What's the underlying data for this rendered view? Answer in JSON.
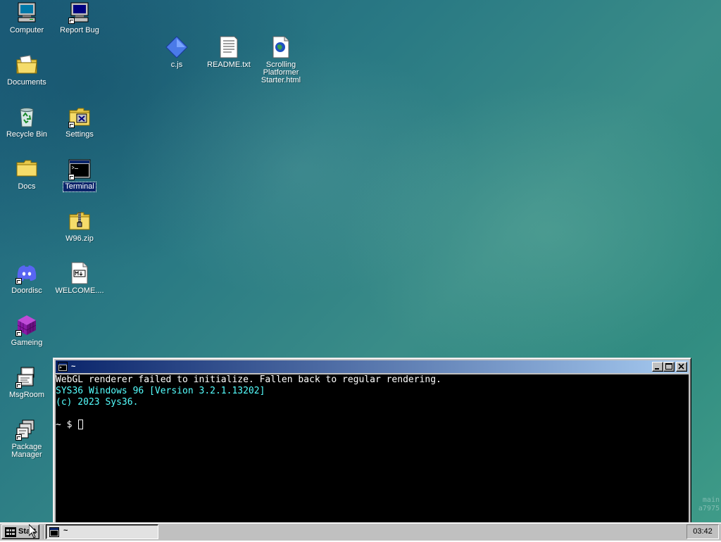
{
  "desktop": {
    "icons": [
      {
        "label": "Computer"
      },
      {
        "label": "Report Bug"
      },
      {
        "label": "Documents"
      },
      {
        "label": "Recycle Bin"
      },
      {
        "label": "Settings"
      },
      {
        "label": "Docs"
      },
      {
        "label": "Terminal"
      },
      {
        "label": "W96.zip"
      },
      {
        "label": "Doordisc"
      },
      {
        "label": "WELCOME...."
      },
      {
        "label": "Gameing"
      },
      {
        "label": "MsgRoom"
      },
      {
        "label": "Package Manager"
      },
      {
        "label": "c.js"
      },
      {
        "label": "README.txt"
      },
      {
        "label": "Scrolling Platformer Starter.html"
      }
    ],
    "watermark": [
      "main",
      "a7975"
    ]
  },
  "terminal": {
    "title": "~",
    "lines": [
      "WebGL renderer failed to initialize. Fallen back to regular rendering.",
      "SYS36 Windows 96 [Version 3.2.1.13202]",
      "(c) 2023 Sys36.",
      "",
      "~ $ "
    ]
  },
  "taskbar": {
    "start_label": "Start",
    "task_label": "~",
    "clock": "03:42"
  },
  "colors": {
    "titlebar_start": "#0a246a",
    "titlebar_end": "#a6caf0",
    "terminal_cyan": "#55ffff",
    "face": "#c0c0c0"
  }
}
